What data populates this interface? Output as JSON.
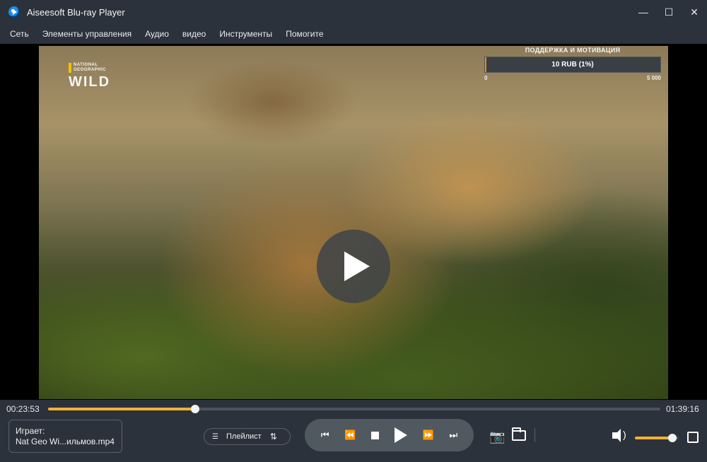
{
  "window": {
    "title": "Aiseesoft Blu-ray Player",
    "logo_icon": "play-disc-icon",
    "controls": {
      "minimize": "—",
      "maximize": "☐",
      "close": "✕"
    }
  },
  "menu": {
    "items": [
      "Сеть",
      "Элементы управления",
      "Аудио",
      "видео",
      "Инструменты",
      "Помогите"
    ]
  },
  "video": {
    "watermark": {
      "small": "NATIONAL GEOGRAPHIC",
      "large": "WILD"
    },
    "donation": {
      "title": "ПОДДЕРЖКА И МОТИВАЦИЯ",
      "amount": "10 RUB (1%)",
      "min": "0",
      "max": "5 000",
      "progress_fraction": 0.01
    },
    "big_play_icon": "play-icon"
  },
  "playback": {
    "current_time": "00:23:53",
    "total_time": "01:39:16",
    "progress_fraction": 0.24
  },
  "now_playing": {
    "label": "Играет:",
    "file": "Nat Geo Wi...ильмов.mp4"
  },
  "playlist": {
    "label": "Плейлист",
    "list_icon": "☰",
    "sort_icon": "⇅"
  },
  "transport": {
    "prev": "⏮",
    "rewind": "⏪",
    "forward": "⏩",
    "next": "⏭"
  },
  "tools": {
    "snapshot_icon": "📷"
  },
  "volume": {
    "level_fraction": 0.86
  },
  "colors": {
    "accent": "#f2b234",
    "bar": "#2b323b"
  }
}
